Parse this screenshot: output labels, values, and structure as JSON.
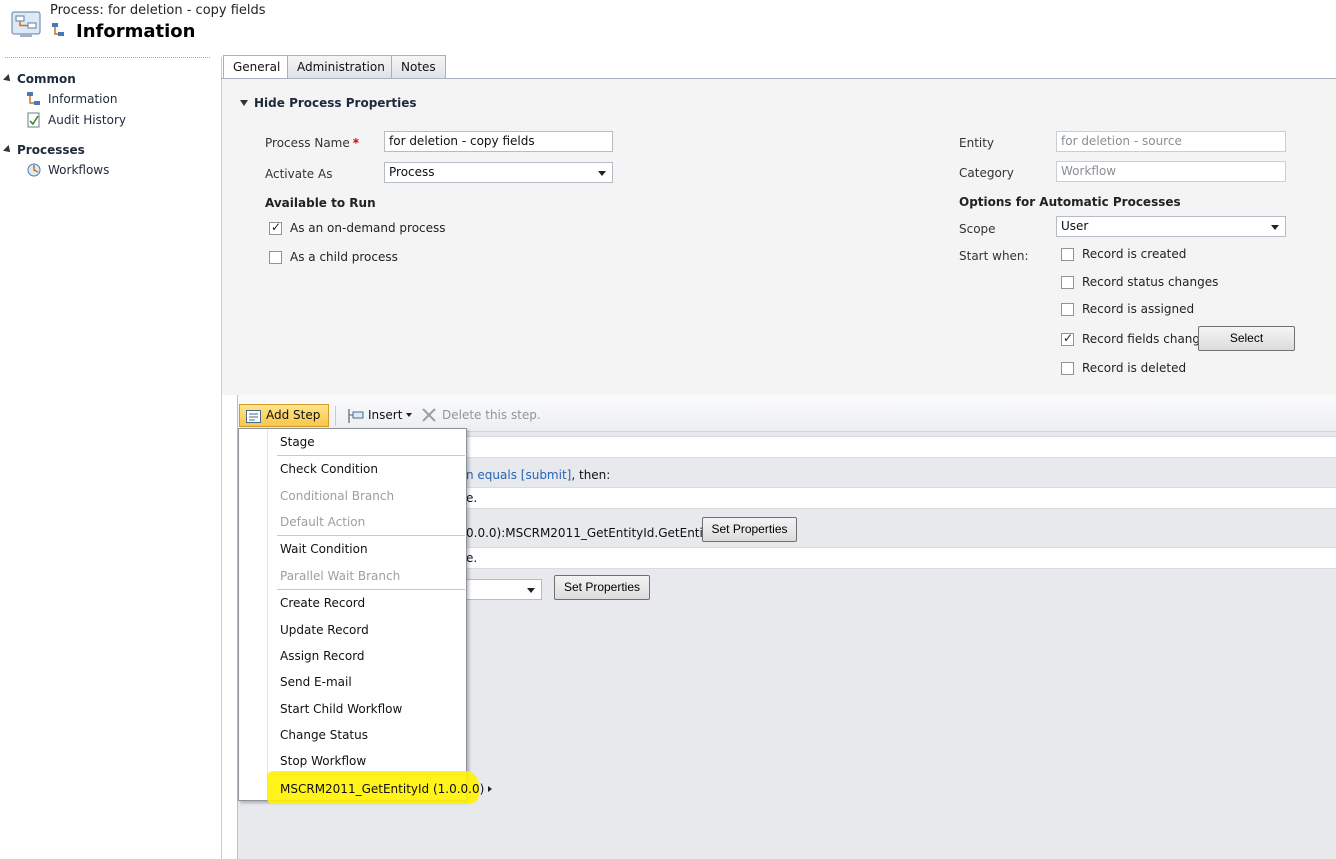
{
  "header": {
    "subtitle": "Process: for deletion - copy fields",
    "title": "Information"
  },
  "nav": {
    "common_label": "Common",
    "common_items": [
      "Information",
      "Audit History"
    ],
    "processes_label": "Processes",
    "processes_items": [
      "Workflows"
    ]
  },
  "tabs": [
    "General",
    "Administration",
    "Notes"
  ],
  "general": {
    "section_label": "Hide Process Properties",
    "process_name_label": "Process Name",
    "process_name_value": "for deletion - copy fields",
    "activate_as_label": "Activate As",
    "activate_as_value": "Process",
    "available_label": "Available to Run",
    "on_demand_label": "As an on-demand process",
    "on_demand_checked": true,
    "child_label": "As a child process",
    "child_checked": false,
    "entity_label": "Entity",
    "entity_value": "for deletion - source",
    "category_label": "Category",
    "category_value": "Workflow",
    "options_label": "Options for Automatic Processes",
    "scope_label": "Scope",
    "scope_value": "User",
    "start_when_label": "Start when:",
    "start_options": [
      {
        "label": "Record is created",
        "checked": false
      },
      {
        "label": "Record status changes",
        "checked": false
      },
      {
        "label": "Record is assigned",
        "checked": false
      },
      {
        "label": "Record fields change",
        "checked": true
      },
      {
        "label": "Record is deleted",
        "checked": false
      }
    ],
    "select_button": "Select"
  },
  "toolbar": {
    "add_step": "Add Step",
    "insert": "Insert",
    "delete_step": "Delete this step."
  },
  "workflow": {
    "condition_link": "n equals [submit]",
    "condition_suffix": ", then:",
    "row2_text": "e.",
    "step_text": "0.0.0):MSCRM2011_GetEntityId.GetEntityId",
    "row4_text": "e.",
    "set_properties": "Set Properties"
  },
  "menu": {
    "items": [
      {
        "label": "Stage",
        "disabled": false
      },
      {
        "label": "Check Condition",
        "disabled": false
      },
      {
        "label": "Conditional Branch",
        "disabled": true
      },
      {
        "label": "Default Action",
        "disabled": true
      },
      {
        "label": "Wait Condition",
        "disabled": false
      },
      {
        "label": "Parallel Wait Branch",
        "disabled": true
      },
      {
        "label": "Create Record",
        "disabled": false
      },
      {
        "label": "Update Record",
        "disabled": false
      },
      {
        "label": "Assign Record",
        "disabled": false
      },
      {
        "label": "Send E-mail",
        "disabled": false
      },
      {
        "label": "Start Child Workflow",
        "disabled": false
      },
      {
        "label": "Change Status",
        "disabled": false
      },
      {
        "label": "Stop Workflow",
        "disabled": false
      }
    ],
    "custom_item": "MSCRM2011_GetEntityId (1.0.0.0)",
    "highlight_color": "#fff200"
  }
}
